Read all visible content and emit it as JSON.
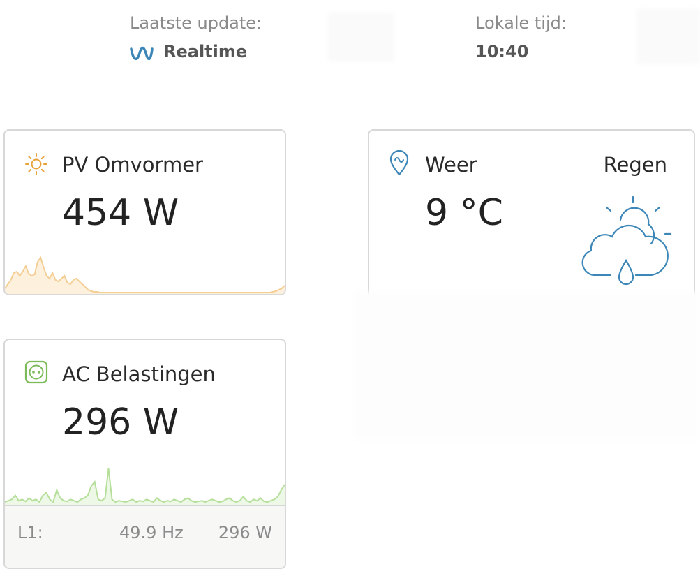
{
  "header": {
    "last_update_label": "Laatste update:",
    "last_update_value": "Realtime",
    "local_time_label": "Lokale tijd:",
    "local_time_value": "10:40"
  },
  "pv_card": {
    "title": "PV Omvormer",
    "value": "454 W",
    "icon": "sun-icon",
    "accent": "#e8a23a",
    "spark_fill": "#fdf0dc",
    "spark_line": "#f3cf95",
    "spark_points": [
      6,
      12,
      18,
      28,
      30,
      24,
      30,
      38,
      27,
      24,
      26,
      44,
      50,
      36,
      24,
      20,
      28,
      18,
      16,
      20,
      24,
      14,
      12,
      18,
      20,
      16,
      12,
      8,
      4,
      2,
      1,
      1,
      0,
      0,
      0,
      0,
      0,
      0,
      0,
      0,
      0,
      0,
      0,
      0,
      0,
      0,
      0,
      0,
      0,
      0,
      0,
      0,
      0,
      0,
      0,
      0,
      0,
      0,
      0,
      0,
      0,
      0,
      0,
      0,
      0,
      0,
      0,
      0,
      0,
      0,
      0,
      0,
      0,
      0,
      0,
      0,
      0,
      0,
      0,
      0,
      0,
      0,
      0,
      0,
      0,
      0,
      0,
      0,
      0,
      0,
      1,
      2,
      4,
      6,
      10
    ]
  },
  "weather_card": {
    "title": "Weer",
    "condition": "Regen",
    "temperature": "9 °C",
    "icon": "location-pin-icon",
    "weather_icon": "rain-cloud-icon",
    "accent": "#3d87b8"
  },
  "ac_card": {
    "title": "AC Belastingen",
    "value": "296 W",
    "icon": "power-socket-icon",
    "accent": "#7dbb5a",
    "spark_fill": "#eef8e6",
    "spark_line": "#b6df9c",
    "spark_points": [
      4,
      6,
      8,
      14,
      6,
      8,
      5,
      10,
      6,
      8,
      4,
      14,
      18,
      8,
      4,
      22,
      10,
      6,
      5,
      8,
      6,
      4,
      8,
      10,
      14,
      28,
      34,
      8,
      6,
      10,
      54,
      8,
      4,
      6,
      5,
      4,
      6,
      8,
      4,
      6,
      5,
      8,
      6,
      4,
      10,
      6,
      4,
      6,
      5,
      8,
      6,
      4,
      8,
      10,
      6,
      4,
      5,
      6,
      4,
      6,
      8,
      6,
      4,
      5,
      8,
      10,
      6,
      4,
      6,
      12,
      6,
      4,
      8,
      6,
      10,
      5,
      4,
      6,
      8,
      12,
      22,
      30
    ],
    "footer": {
      "phase": "L1:",
      "frequency": "49.9 Hz",
      "power": "296 W"
    }
  }
}
